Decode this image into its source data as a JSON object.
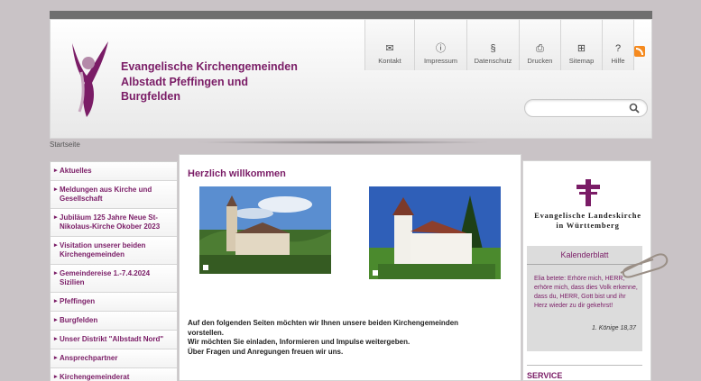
{
  "header": {
    "brand_lines": [
      "Evangelische Kirchengemeinden",
      "Albstadt Pfeffingen und",
      "Burgfelden"
    ],
    "search": {
      "placeholder": ""
    },
    "toolbar": [
      {
        "label": "Kontakt",
        "icon": "envelope-icon"
      },
      {
        "label": "Impressum",
        "icon": "info-icon"
      },
      {
        "label": "Datenschutz",
        "icon": "paragraph-icon"
      },
      {
        "label": "Drucken",
        "icon": "printer-icon"
      },
      {
        "label": "Sitemap",
        "icon": "sitemap-icon"
      },
      {
        "label": "Hilfe",
        "icon": "help-icon"
      }
    ],
    "rss_icon": "rss-icon"
  },
  "breadcrumb": "Startseite",
  "nav": [
    "Aktuelles",
    "Meldungen aus Kirche und Gesellschaft",
    "Jubiläum 125 Jahre Neue St-Nikolaus-Kirche Okober 2023",
    "Visitation unserer beiden Kirchengemeinden",
    "Gemeindereise 1.-7.4.2024 Sizilien",
    "Pfeffingen",
    "Burgfelden",
    "Unser Distrikt \"Albstadt Nord\"",
    "Ansprechpartner",
    "Kirchengemeinderat"
  ],
  "main": {
    "heading": "Herzlich willkommen",
    "body_lines": [
      "Auf den folgenden Seiten möchten wir Ihnen unsere beiden Kirchengemeinden",
      "vorstellen.",
      "Wir möchten Sie einladen, Informieren und Impulse weitergeben.",
      "Über Fragen und Anregungen freuen wir uns."
    ]
  },
  "sidebar": {
    "lkw_lines": [
      "Evangelische Landeskirche",
      "in Württemberg"
    ],
    "kalender": {
      "title": "Kalenderblatt",
      "verse": "Elia betete: Erhöre mich, HERR, erhöre mich, dass dies Volk erkenne, dass du, HERR, Gott bist und ihr Herz wieder zu dir gekehrst!",
      "reference": "1. Könige 18,37"
    },
    "service_heading": "SERVICE"
  },
  "colors": {
    "accent": "#7a1c66",
    "background": "#c9c3c6",
    "rss": "#f58a1f"
  }
}
